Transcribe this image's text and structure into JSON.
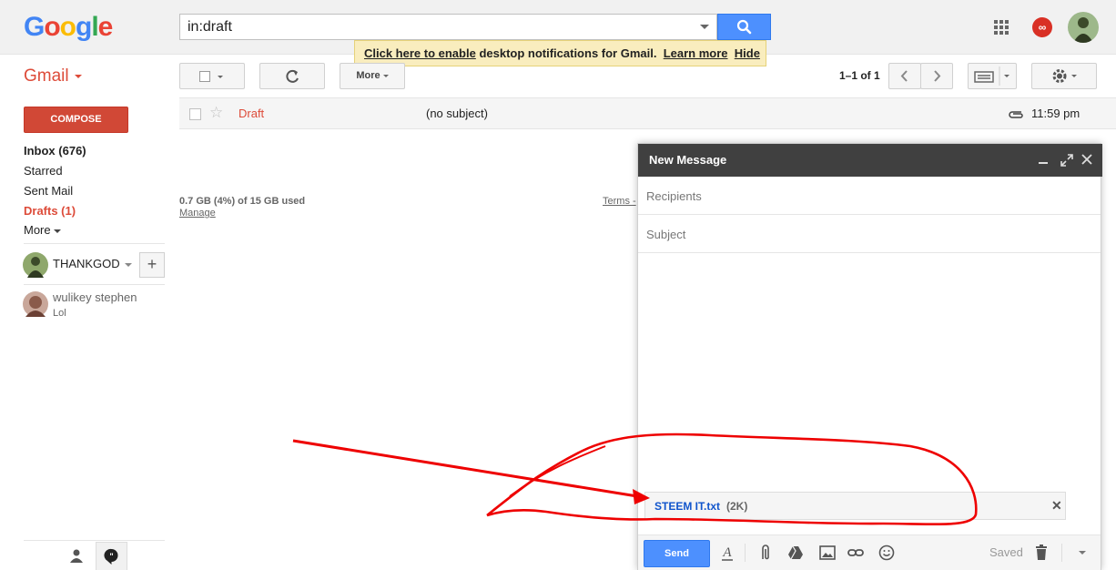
{
  "header": {
    "logo": [
      "G",
      "o",
      "o",
      "g",
      "l",
      "e"
    ],
    "logo_colors": [
      "#4285f4",
      "#ea4335",
      "#fbbc05",
      "#4285f4",
      "#34a853",
      "#ea4335"
    ],
    "search_value": "in:draft",
    "notification": {
      "enable_link": "Click here to enable",
      "text": " desktop notifications for Gmail.",
      "learn_more": "Learn more",
      "hide": "Hide"
    },
    "notif_badge": "∞"
  },
  "toolbar": {
    "gmail_label": "Gmail",
    "more_label": "More",
    "pager_text": "1–1 of 1"
  },
  "sidebar": {
    "compose": "COMPOSE",
    "items": [
      {
        "label": "Inbox (676)"
      },
      {
        "label": "Starred"
      },
      {
        "label": "Sent Mail"
      },
      {
        "label": "Drafts (1)"
      },
      {
        "label": "More"
      }
    ],
    "hangouts_user": "THANKGOD",
    "add_label": "+",
    "contact": {
      "name": "wulikey stephen",
      "message": "Lol"
    }
  },
  "message_list": {
    "rows": [
      {
        "from": "Draft",
        "subject": "(no subject)",
        "time": "11:59 pm"
      }
    ],
    "storage": "0.7 GB (4%) of 15 GB used",
    "manage": "Manage",
    "terms": "Terms -"
  },
  "compose_window": {
    "title": "New Message",
    "recipients_placeholder": "Recipients",
    "subject_placeholder": "Subject",
    "attachment": {
      "name": "STEEM IT.txt",
      "size": "(2K)"
    },
    "send": "Send",
    "saved": "Saved"
  },
  "colors": {
    "accent_blue": "#4d90fe",
    "gmail_red": "#dd4b39",
    "annotation_red": "#ee0000"
  }
}
